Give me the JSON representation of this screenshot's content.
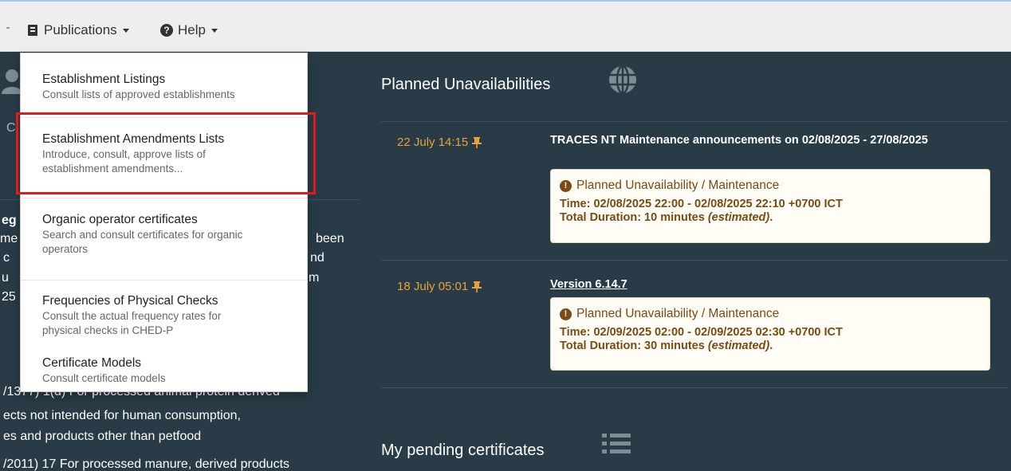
{
  "navbar": {
    "publications_label": "Publications",
    "help_label": "Help"
  },
  "dropdown": {
    "items": [
      {
        "title": "Establishment Listings",
        "desc": "Consult lists of approved establishments"
      },
      {
        "title": "Establishment Amendments Lists",
        "desc": "Introduce, consult, approve lists of establishment amendments..."
      },
      {
        "title": "Organic operator certificates",
        "desc": "Search and consult certificates for organic operators"
      },
      {
        "title": "Frequencies of Physical Checks",
        "desc": "Consult the actual frequency rates for physical checks in CHED-P"
      },
      {
        "title": "Certificate Models",
        "desc": "Consult certificate models"
      }
    ]
  },
  "left_col": {
    "frag_c": "C",
    "frag_eg": "eg",
    "frag_me": "me",
    "frag_c2": "c",
    "frag_u": "u",
    "frag_25": "25",
    "frag_been": "been",
    "frag_nd": "nd",
    "frag_m": "m",
    "line1": "/1377) 1(d) For processed animal protein derived",
    "line2": "ects not intended for human consumption,",
    "line3": "es and products other than petfood",
    "line4": "/2011) 17 For processed manure, derived products"
  },
  "unavailabilities": {
    "title": "Planned Unavailabilities",
    "entries": [
      {
        "date": "22 July 14:15",
        "title": "TRACES NT Maintenance announcements on 02/08/2025 - 27/08/2025",
        "notice_type": "Planned Unavailability / Maintenance",
        "time": "Time: 02/08/2025 22:00 - 02/08/2025 22:10 +0700 ICT",
        "duration": "Total Duration: 10 minutes",
        "estimated": "(estimated)",
        "period": "."
      },
      {
        "date": "18 July 05:01",
        "title": "Version 6.14.7",
        "notice_type": "Planned Unavailability / Maintenance",
        "time": "Time: 02/09/2025 02:00 - 02/09/2025 02:30 +0700 ICT",
        "duration": "Total Duration: 30 minutes",
        "estimated": "(estimated)",
        "period": "."
      }
    ]
  },
  "pending": {
    "title": "My pending certificates"
  },
  "colors": {
    "background": "#283b46",
    "accent_date": "#e8a23a",
    "highlight_border": "#e01b1b",
    "notice_text": "#7a4a12"
  }
}
